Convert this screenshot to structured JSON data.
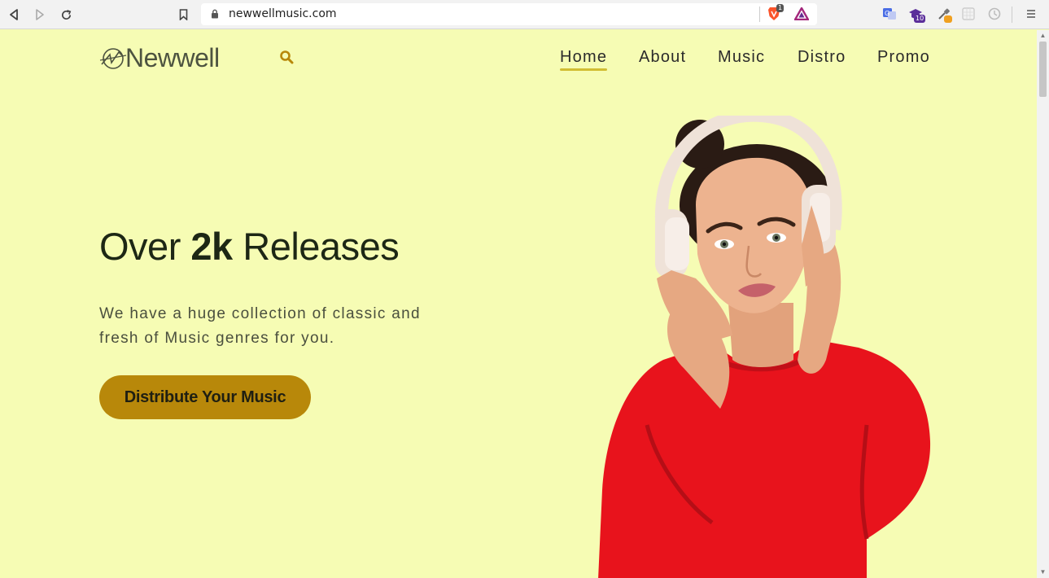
{
  "browser": {
    "url": "newwellmusic.com",
    "brave_badge": "1",
    "ext_badge": "10"
  },
  "site": {
    "logo_text": "Newwell",
    "nav": [
      {
        "label": "Home",
        "active": true
      },
      {
        "label": "About"
      },
      {
        "label": "Music"
      },
      {
        "label": "Distro"
      },
      {
        "label": "Promo"
      }
    ]
  },
  "hero": {
    "headline_prefix": "Over",
    "headline_bold": "2k",
    "headline_suffix": "Releases",
    "subtext": "We have a huge collection of classic and fresh of Music genres for you.",
    "cta_label": "Distribute Your Music"
  },
  "colors": {
    "page_bg": "#f6fcb4",
    "accent": "#b8880a",
    "nav_underline": "#d1bd33",
    "shirt": "#e8131c"
  }
}
